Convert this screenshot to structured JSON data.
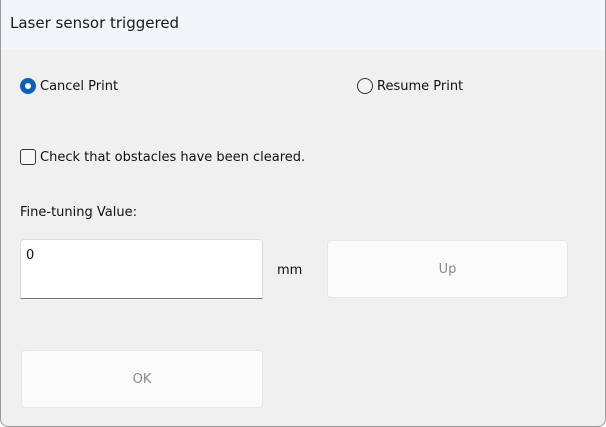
{
  "window": {
    "title": "Laser sensor triggered"
  },
  "options": {
    "cancel_label": "Cancel Print",
    "cancel_selected": true,
    "resume_label": "Resume Print",
    "resume_selected": false
  },
  "confirm": {
    "checkbox_label": "Check that obstacles have been cleared.",
    "checked": false
  },
  "fine_tuning": {
    "label": "Fine-tuning Value:",
    "value": "0",
    "unit": "mm",
    "up_label": "Up"
  },
  "actions": {
    "ok_label": "OK"
  },
  "colors": {
    "accent": "#0a5fc1",
    "window_bg": "#f0f0f0",
    "titlebar_bg": "#f3f5fa",
    "disabled_text": "#8a8a8a"
  }
}
